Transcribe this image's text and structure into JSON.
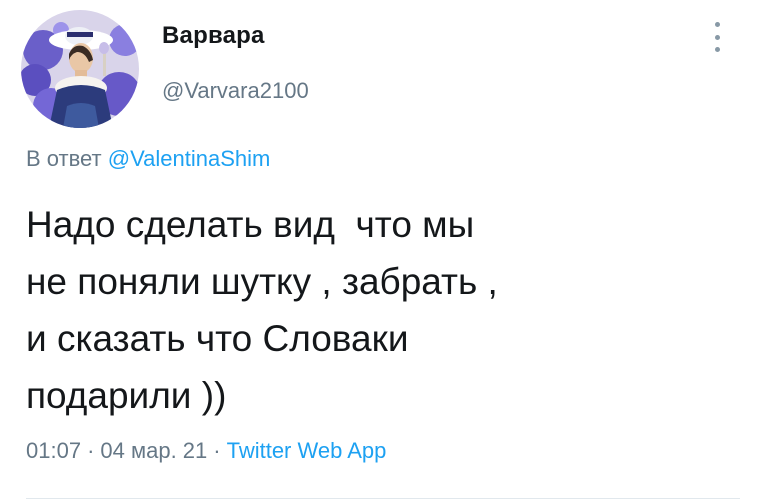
{
  "author": {
    "display_name": "Варвара",
    "handle": "@Varvara2100",
    "avatar_icon": "painted-portrait-avatar"
  },
  "reply": {
    "prefix": "В ответ",
    "mention": "@ValentinaShim"
  },
  "tweet": {
    "lines": [
      "Надо сделать вид  что мы",
      "не поняли шутку , забрать ,",
      "и сказать что Словаки",
      "подарили ))"
    ]
  },
  "meta": {
    "time": "01:07",
    "separator": "·",
    "date": "04 мар. 21",
    "source": "Twitter Web App"
  },
  "icons": {
    "more": "more-vertical-icon"
  },
  "colors": {
    "text": "#14171a",
    "secondary": "#657786",
    "link": "#1da1f2"
  }
}
